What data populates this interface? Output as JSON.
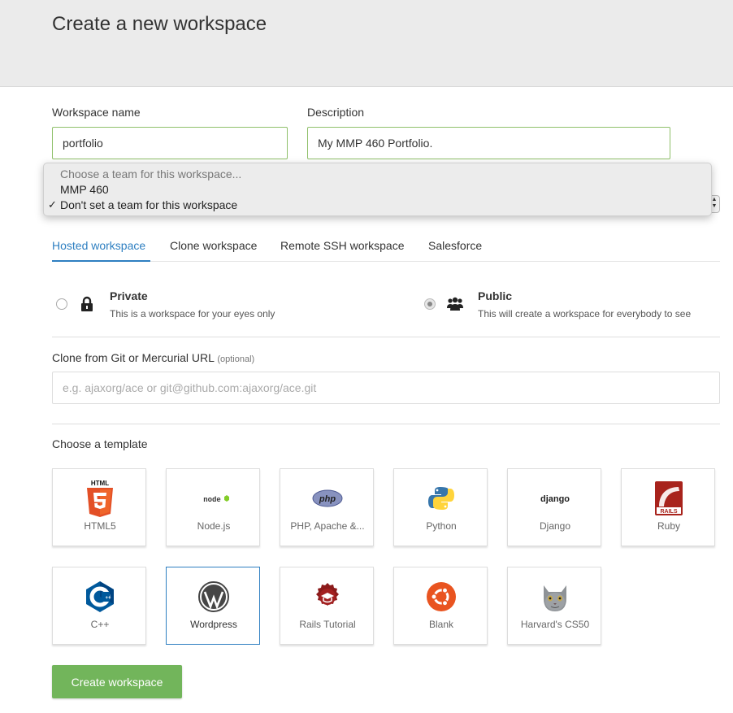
{
  "header": {
    "title": "Create a new workspace"
  },
  "form": {
    "workspace_name_label": "Workspace name",
    "workspace_name_value": "portfolio",
    "description_label": "Description",
    "description_value": "My MMP 460 Portfolio."
  },
  "team_dropdown": {
    "header_option": "Choose a team for this workspace...",
    "options": [
      "MMP 460",
      "Don't set a team for this workspace"
    ],
    "selected_mark": "✓"
  },
  "tabs": [
    {
      "label": "Hosted workspace",
      "active": true
    },
    {
      "label": "Clone workspace",
      "active": false
    },
    {
      "label": "Remote SSH workspace",
      "active": false
    },
    {
      "label": "Salesforce",
      "active": false
    }
  ],
  "visibility": {
    "private": {
      "title": "Private",
      "desc": "This is a workspace for your eyes only",
      "icon": "lock-icon",
      "selected": false
    },
    "public": {
      "title": "Public",
      "desc": "This will create a workspace for everybody to see",
      "icon": "users-icon",
      "selected": true
    }
  },
  "clone": {
    "label": "Clone from Git or Mercurial URL",
    "optional": "(optional)",
    "placeholder": "e.g. ajaxorg/ace or git@github.com:ajaxorg/ace.git"
  },
  "templates": {
    "label": "Choose a template",
    "items": [
      {
        "name": "HTML5",
        "icon": "html5-icon"
      },
      {
        "name": "Node.js",
        "icon": "nodejs-icon",
        "logo_text": "node"
      },
      {
        "name": "PHP, Apache &...",
        "icon": "php-icon",
        "logo_text": "php"
      },
      {
        "name": "Python",
        "icon": "python-icon"
      },
      {
        "name": "Django",
        "icon": "django-icon",
        "logo_text": "django"
      },
      {
        "name": "Ruby",
        "icon": "rails-icon",
        "logo_text": "RAILS"
      },
      {
        "name": "C++",
        "icon": "cpp-icon"
      },
      {
        "name": "Wordpress",
        "icon": "wordpress-icon",
        "selected": true
      },
      {
        "name": "Rails Tutorial",
        "icon": "rails-tutorial-icon"
      },
      {
        "name": "Blank",
        "icon": "ubuntu-icon"
      },
      {
        "name": "Harvard's CS50",
        "icon": "cat-icon"
      }
    ],
    "html5_logo_text": "HTML"
  },
  "actions": {
    "create_label": "Create workspace"
  },
  "colors": {
    "accent_blue": "#2e7fc1",
    "valid_green": "#8fc06a",
    "button_green": "#72b55b",
    "header_bg": "#ebebeb"
  }
}
